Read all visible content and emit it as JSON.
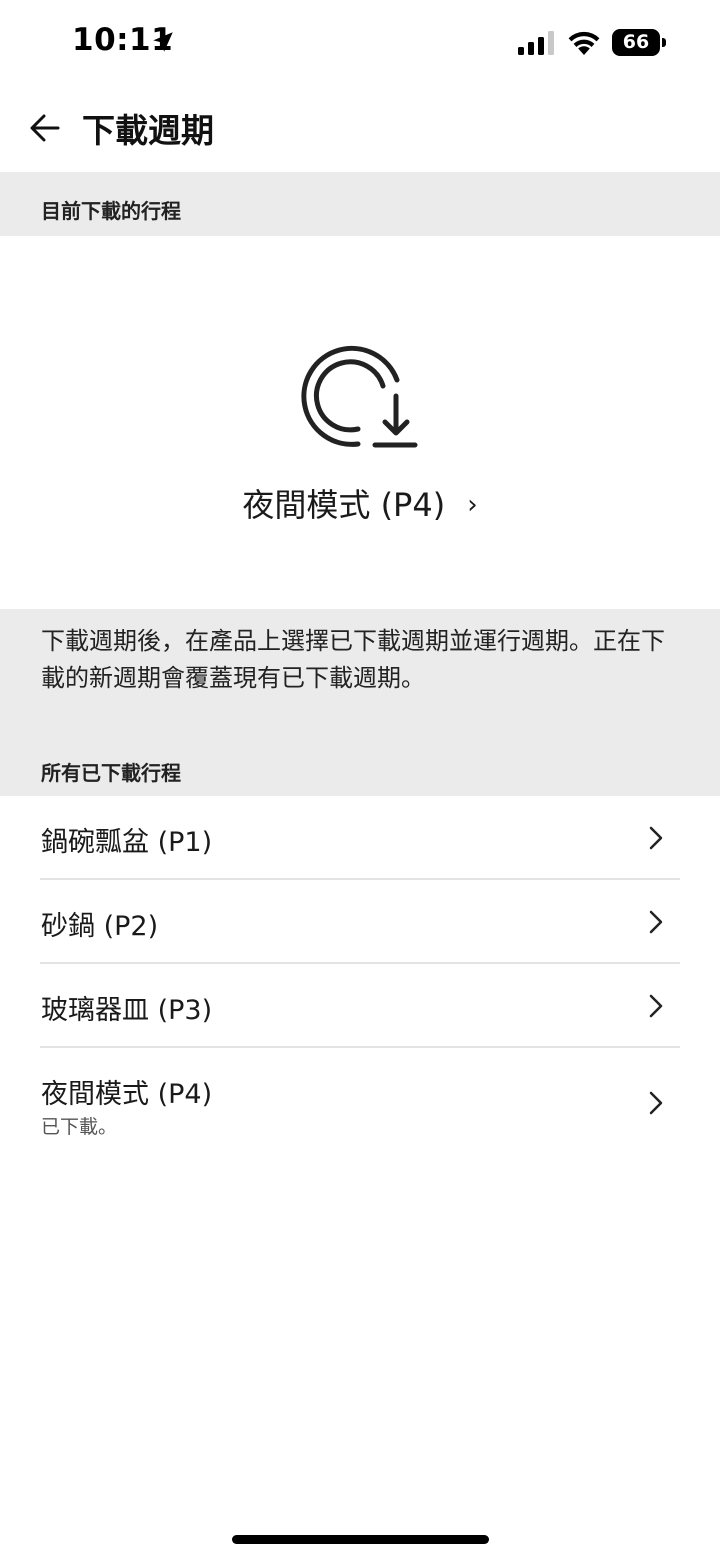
{
  "status_bar": {
    "time": "10:11",
    "battery": "66"
  },
  "nav": {
    "title": "下載週期"
  },
  "current_section": {
    "header": "目前下載的行程",
    "cycle_name": "夜間模式 (P4)"
  },
  "info": {
    "text": "下載週期後，在產品上選擇已下載週期並運行週期。正在下載的新週期會覆蓋現有已下載週期。"
  },
  "all_section": {
    "header": "所有已下載行程",
    "items": [
      {
        "label": "鍋碗瓢盆 (P1)",
        "sub": ""
      },
      {
        "label": "砂鍋 (P2)",
        "sub": ""
      },
      {
        "label": "玻璃器皿 (P3)",
        "sub": ""
      },
      {
        "label": "夜間模式 (P4)",
        "sub": "已下載。"
      }
    ]
  },
  "icons": {
    "back": "arrow-left-icon",
    "cycle_download": "cycle-download-icon",
    "chevron": "chevron-right-icon",
    "location": "location-arrow-icon",
    "signal": "cellular-signal-icon",
    "wifi": "wifi-icon"
  },
  "colors": {
    "section_bg": "#ebebeb",
    "text": "#1a1a1a",
    "divider": "#e3e3e3"
  }
}
